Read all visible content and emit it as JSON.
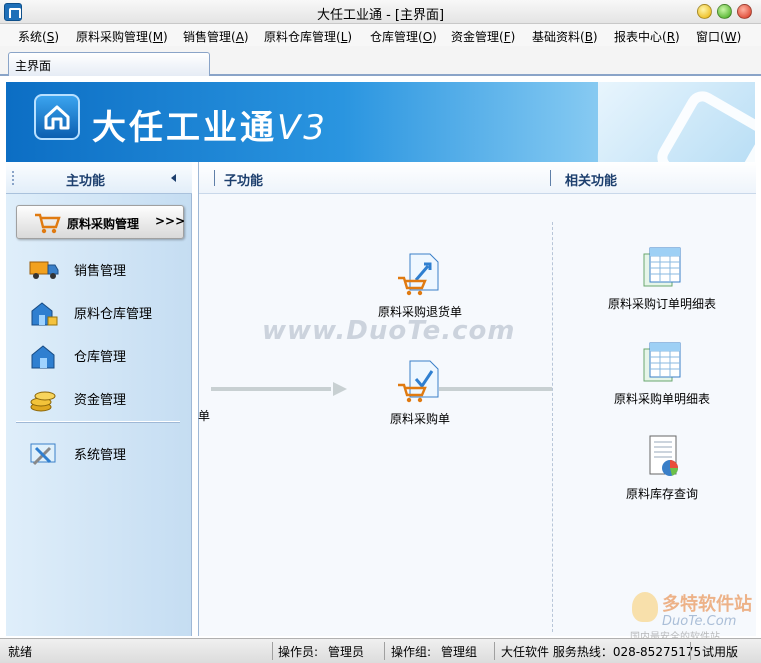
{
  "window": {
    "title": "大任工业通 - [主界面]"
  },
  "menu": [
    {
      "label": "系统(",
      "key": "S",
      "end": ")"
    },
    {
      "label": "原料采购管理(",
      "key": "M",
      "end": ")"
    },
    {
      "label": "销售管理(",
      "key": "A",
      "end": ")"
    },
    {
      "label": "原料仓库管理(",
      "key": "L",
      "end": ")"
    },
    {
      "label": "仓库管理(",
      "key": "O",
      "end": ")"
    },
    {
      "label": "资金管理(",
      "key": "F",
      "end": ")"
    },
    {
      "label": "基础资料(",
      "key": "B",
      "end": ")"
    },
    {
      "label": "报表中心(",
      "key": "R",
      "end": ")"
    },
    {
      "label": "窗口(",
      "key": "W",
      "end": ")"
    }
  ],
  "tab": {
    "label": "主界面"
  },
  "banner": {
    "brand": "大任工业通",
    "version": "V3"
  },
  "sidebar": {
    "header": "主功能",
    "active": {
      "label": "原料采购管理",
      "chevron": ">>>"
    },
    "items": [
      {
        "label": "销售管理",
        "icon": "truck-icon"
      },
      {
        "label": "原料仓库管理",
        "icon": "warehouse-icon"
      },
      {
        "label": "仓库管理",
        "icon": "house-icon"
      },
      {
        "label": "资金管理",
        "icon": "coins-icon"
      },
      {
        "label": "系统管理",
        "icon": "tools-icon"
      }
    ]
  },
  "content": {
    "sub_header": "子功能",
    "related_header": "相关功能",
    "cut_label": "单",
    "sub_functions": [
      {
        "label": "原料采购退货单",
        "icon": "return-order-icon"
      },
      {
        "label": "原料采购单",
        "icon": "purchase-order-icon"
      }
    ],
    "related_functions": [
      {
        "label": "原料采购订单明细表",
        "icon": "spreadsheet-icon"
      },
      {
        "label": "原料采购单明细表",
        "icon": "spreadsheet-icon"
      },
      {
        "label": "原料库存查询",
        "icon": "report-chart-icon"
      }
    ]
  },
  "watermark": "www.DuoTe.com",
  "corner_logo": {
    "brand": "多特软件站",
    "site": "DuoTe.Com",
    "slogan": "国内最安全的软件站"
  },
  "status": {
    "state": "就绪",
    "operator_label": "操作员:",
    "operator": "管理员",
    "group_label": "操作组:",
    "group": "管理组",
    "hotline": "大任软件 服务热线：028-85275175",
    "edition": "试用版"
  }
}
